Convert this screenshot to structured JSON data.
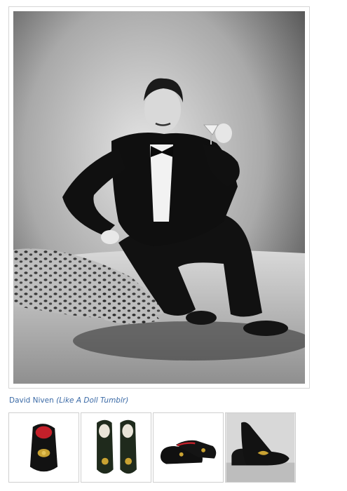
{
  "photo": {
    "alt": "Black and white studio portrait of a man in a tuxedo seated on a leopard rug holding a cocktail glass"
  },
  "caption": {
    "name": "David Niven",
    "source": "(Like A Doll Tumblr)"
  },
  "thumbnails": [
    {
      "alt": "Black velvet slipper with red lining and gold embroidered crest"
    },
    {
      "alt": "Pair of dark green velvet slippers with gold monogram"
    },
    {
      "alt": "Black velvet loafers with red piping"
    },
    {
      "alt": "Black velvet slippers with gold fox embroidery"
    }
  ]
}
